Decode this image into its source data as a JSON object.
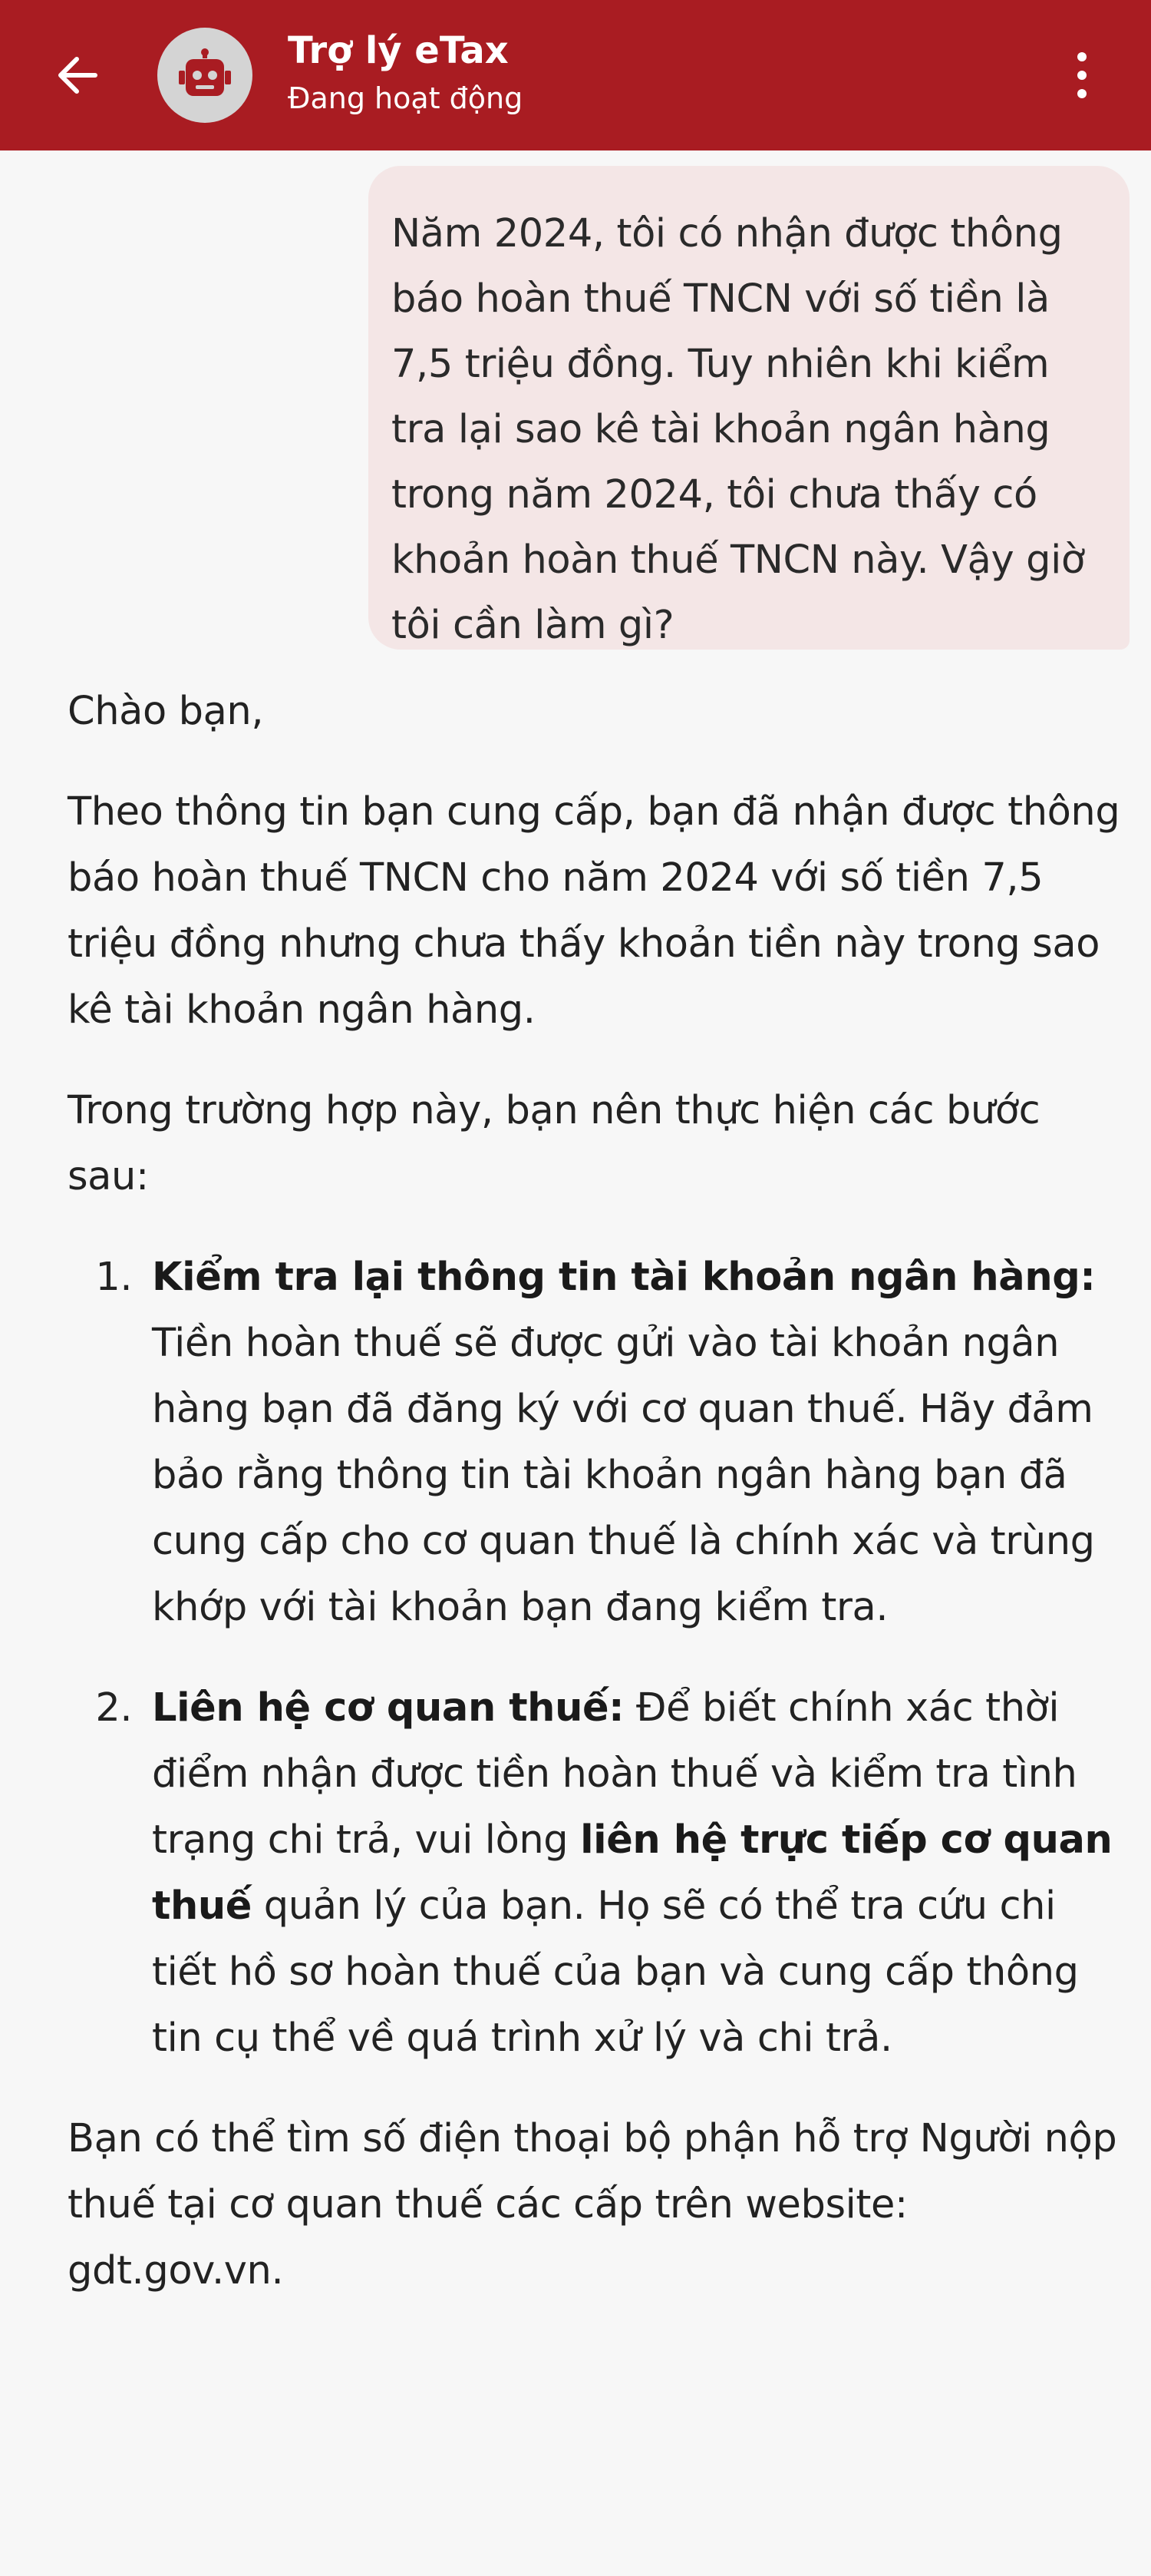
{
  "header": {
    "title": "Trợ lý eTax",
    "status": "Đang hoạt động",
    "back_icon": "arrow-left-icon",
    "avatar_icon": "robot-icon",
    "menu_icon": "more-vertical-icon",
    "background_color": "#a91c22"
  },
  "user_message": {
    "text": "Năm 2024, tôi có nhận được thông báo hoàn thuế TNCN với số tiền là 7,5 triệu đồng. Tuy nhiên khi kiểm tra lại sao kê tài khoản ngân hàng trong năm 2024, tôi chưa thấy có khoản hoàn thuế TNCN này. Vậy giờ tôi cần làm gì?"
  },
  "bot_reply": {
    "greeting": "Chào bạn,",
    "summary": "Theo thông tin bạn cung cấp, bạn đã nhận được thông báo hoàn thuế TNCN cho năm 2024 với số tiền 7,5 triệu đồng nhưng chưa thấy khoản tiền này trong sao kê tài khoản ngân hàng.",
    "intro": "Trong trường hợp này, bạn nên thực hiện các bước sau:",
    "steps": [
      {
        "title": "Kiểm tra lại thông tin tài khoản ngân hàng:",
        "body": " Tiền hoàn thuế sẽ được gửi vào tài khoản ngân hàng bạn đã đăng ký với cơ quan thuế. Hãy đảm bảo rằng thông tin tài khoản ngân hàng bạn đã cung cấp cho cơ quan thuế là chính xác và trùng khớp với tài khoản bạn đang kiểm tra."
      },
      {
        "title": "Liên hệ cơ quan thuế:",
        "body_before": " Để biết chính xác thời điểm nhận được tiền hoàn thuế và kiểm tra tình trạng chi trả, vui lòng ",
        "body_bold": "liên hệ trực tiếp cơ quan thuế",
        "body_after": " quản lý của bạn. Họ sẽ có thể tra cứu chi tiết hồ sơ hoàn thuế của bạn và cung cấp thông tin cụ thể về quá trình xử lý và chi trả."
      }
    ],
    "closing": "Bạn có thể tìm số điện thoại bộ phận hỗ trợ Người nộp thuế tại cơ quan thuế các cấp trên website: gdt.gov.vn."
  }
}
